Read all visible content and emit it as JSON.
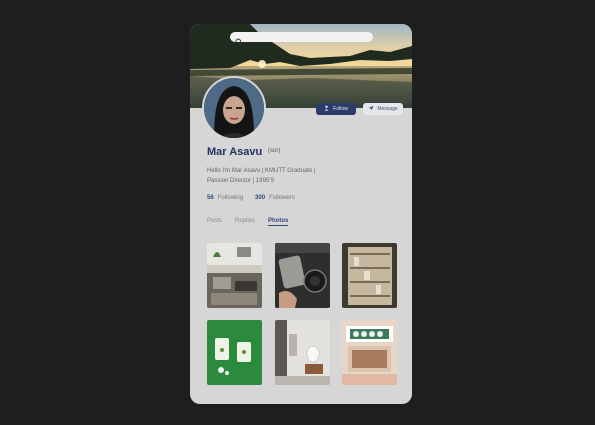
{
  "profile": {
    "name": "Mar Asavu",
    "pronouns": "(sur)",
    "bio_line1": "Hello I'm Mar Asavu | KMUTT Graduate |",
    "bio_line2": "Passion Director | 1995'S",
    "following_count": "56",
    "following_label": "Following",
    "followers_count": "300",
    "followers_label": "Followers"
  },
  "actions": {
    "follow_label": "Follow",
    "message_label": "Message"
  },
  "search": {
    "placeholder": ""
  },
  "tabs": [
    {
      "label": "Posts",
      "active": false
    },
    {
      "label": "Replies",
      "active": false
    },
    {
      "label": "Photos",
      "active": true
    }
  ],
  "photos": [
    {
      "subject": "workspace desk"
    },
    {
      "subject": "camera equipment"
    },
    {
      "subject": "shelves of items"
    },
    {
      "subject": "green drinks"
    },
    {
      "subject": "white room interior"
    },
    {
      "subject": "shop storefront"
    }
  ],
  "colors": {
    "background": "#1e1e1e",
    "card": "#d6d6d6",
    "accent": "#2d3b6a",
    "name": "#23335e"
  },
  "icons": [
    "search-icon",
    "user-plus-icon",
    "send-icon"
  ]
}
